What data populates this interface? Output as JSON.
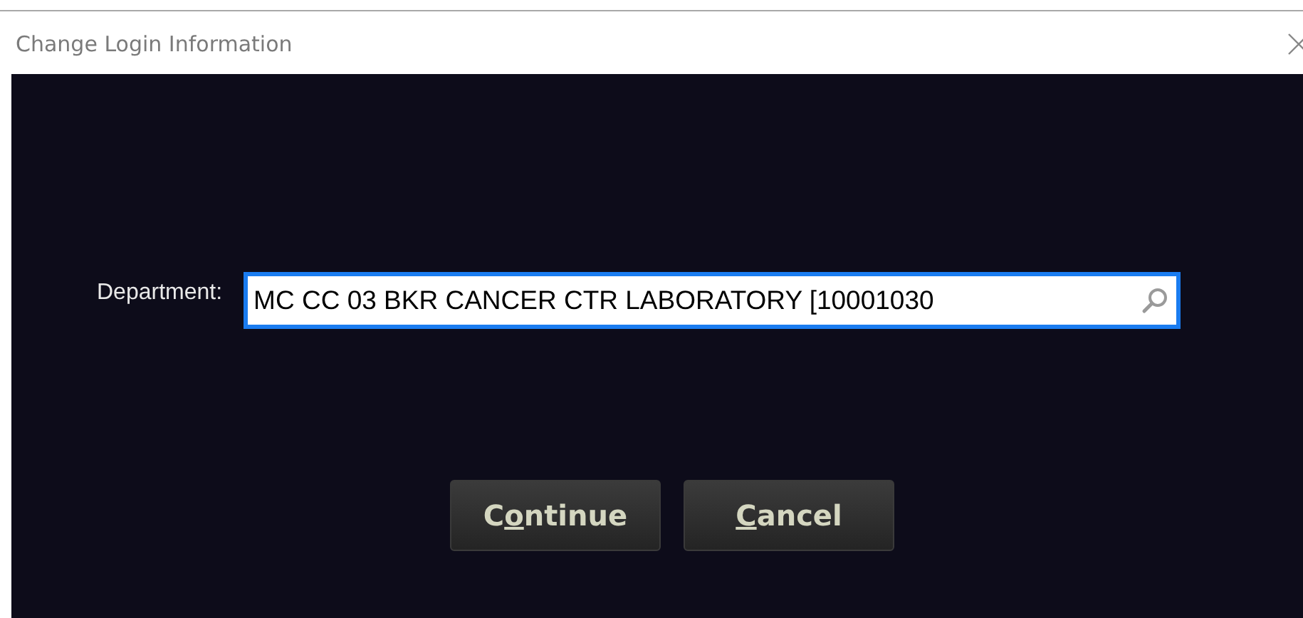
{
  "window": {
    "title": "Change Login Information"
  },
  "department": {
    "label": "Department:",
    "value": "MC CC 03 BKR CANCER CTR LABORATORY [10001030"
  },
  "buttons": [
    {
      "label": [
        {
          "text": "C",
          "underlined": false
        },
        {
          "text": "o",
          "underlined": true
        },
        {
          "text": "ntinue",
          "underlined": false
        }
      ]
    },
    {
      "label": [
        {
          "text": "C",
          "underlined": true
        },
        {
          "text": "ancel",
          "underlined": false
        }
      ]
    }
  ]
}
